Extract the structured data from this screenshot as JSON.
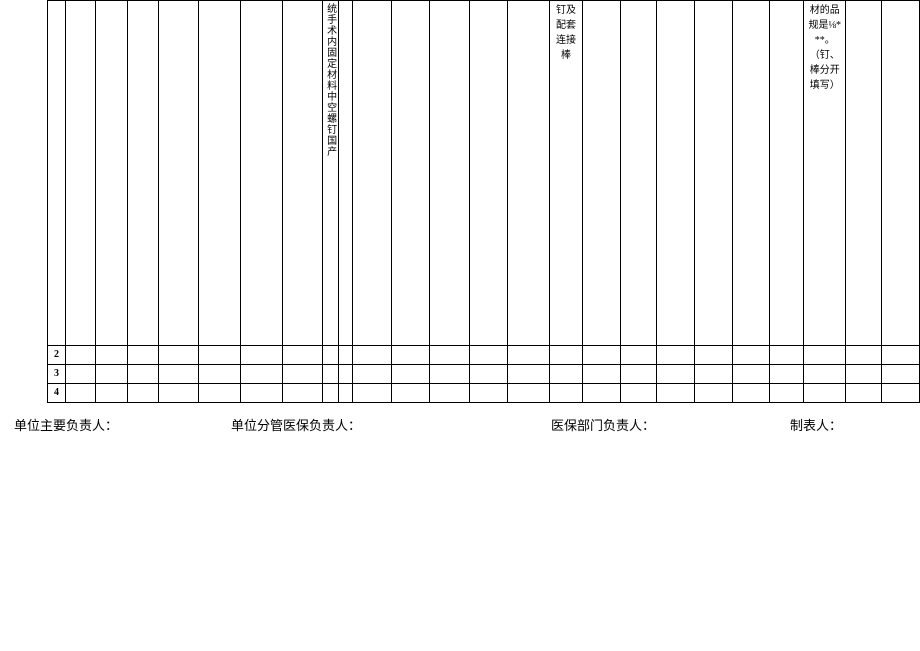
{
  "table": {
    "col8_text": "统手术内固定材料中空螺钉国产",
    "col15_text": "钉及配套连接棒",
    "col22_text": "材的品规是⅛***。（钉、棒分开填写）",
    "row_labels": [
      "2",
      "3",
      "4"
    ]
  },
  "signatures": {
    "s1": "单位主要负责人：",
    "s2": "单位分管医保负责人：",
    "s3": "医保部门负责人：",
    "s4": "制表人："
  }
}
